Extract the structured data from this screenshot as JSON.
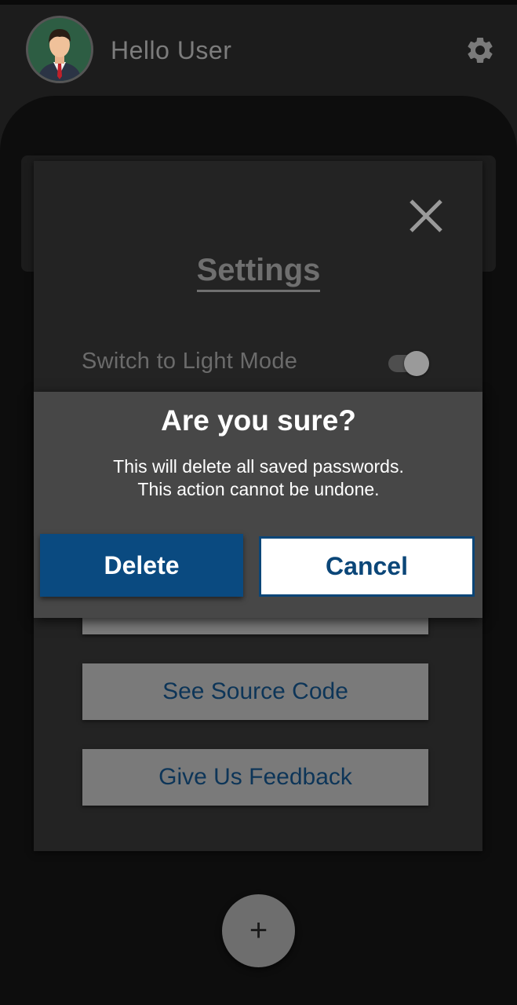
{
  "header": {
    "greeting": "Hello User",
    "avatar": "user-avatar-icon",
    "settings_icon": "gear-icon"
  },
  "settings": {
    "title": "Settings",
    "close_icon": "close-icon",
    "light_mode_label": "Switch to Light Mode",
    "light_mode_on": false,
    "buttons": [
      {
        "label": ""
      },
      {
        "label": "See Source Code"
      },
      {
        "label": "Give Us Feedback"
      }
    ]
  },
  "dialog": {
    "title": "Are you sure?",
    "message_line1": "This will delete all saved passwords.",
    "message_line2": "This action cannot be undone.",
    "confirm_label": "Delete",
    "cancel_label": "Cancel"
  },
  "fab": {
    "label": "+",
    "icon": "plus-icon"
  },
  "colors": {
    "primary": "#0a4a80",
    "header_bg": "#1c1c1c",
    "dialog_bg": "#474747",
    "button_gray": "#7a7a7a"
  }
}
